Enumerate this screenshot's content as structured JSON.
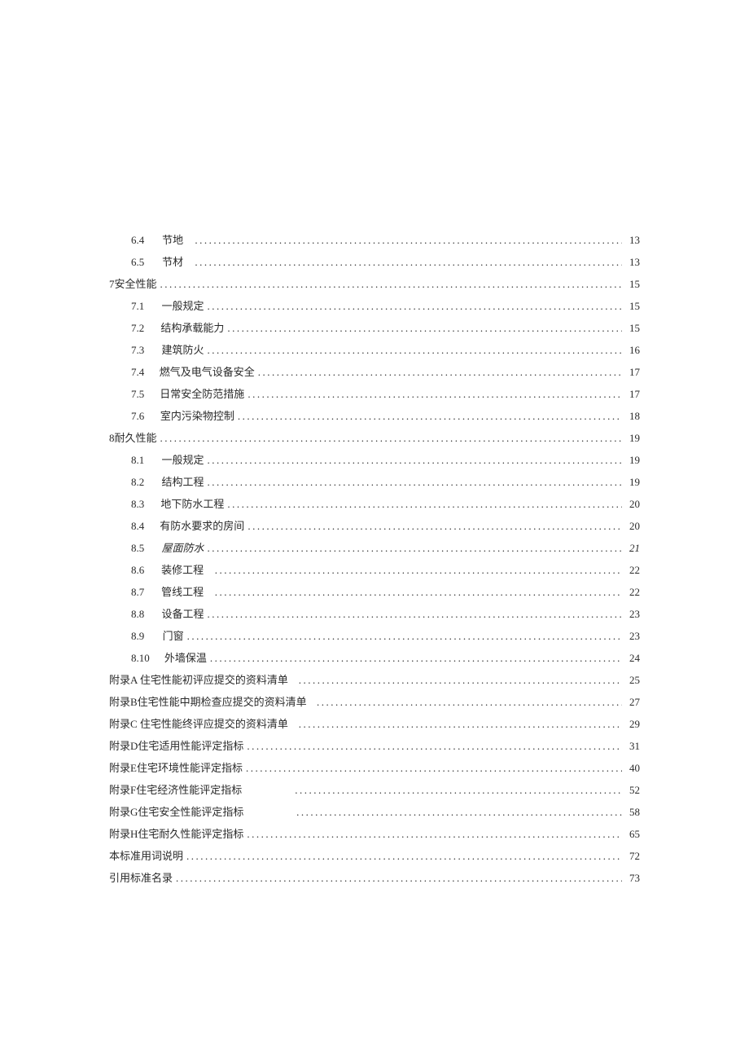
{
  "toc": {
    "entries": [
      {
        "level": "sub",
        "num": "6.4",
        "title": "节地",
        "gap": 14,
        "page": "13"
      },
      {
        "level": "sub",
        "num": "6.5",
        "title": "节材",
        "gap": 14,
        "page": "13"
      },
      {
        "level": "top",
        "num": "",
        "title": "7安全性能",
        "gap": 0,
        "page": "15"
      },
      {
        "level": "sub",
        "num": "7.1",
        "title": "一般规定",
        "gap": 0,
        "page": "15"
      },
      {
        "level": "sub",
        "num": "7.2",
        "title": "结构承载能力",
        "gap": 0,
        "page": "15"
      },
      {
        "level": "sub",
        "num": "7.3",
        "title": "建筑防火",
        "gap": 0,
        "page": "16"
      },
      {
        "level": "sub",
        "num": "7.4",
        "title": "燃气及电气设备安全",
        "gap": 0,
        "page": "17"
      },
      {
        "level": "sub",
        "num": "7.5",
        "title": "日常安全防范措施",
        "gap": 0,
        "page": "17"
      },
      {
        "level": "sub",
        "num": "7.6",
        "title": "室内污染物控制",
        "gap": 0,
        "page": "18"
      },
      {
        "level": "top",
        "num": "",
        "title": "8耐久性能",
        "gap": 0,
        "page": "19"
      },
      {
        "level": "sub",
        "num": "8.1",
        "title": "一般规定",
        "gap": 0,
        "page": "19"
      },
      {
        "level": "sub",
        "num": "8.2",
        "title": "结构工程",
        "gap": 0,
        "page": "19"
      },
      {
        "level": "sub",
        "num": "8.3",
        "title": "地下防水工程",
        "gap": 0,
        "page": "20"
      },
      {
        "level": "sub",
        "num": "8.4",
        "title": "有防水要求的房间",
        "gap": 0,
        "page": "20"
      },
      {
        "level": "sub",
        "num": "8.5",
        "title": "屋面防水",
        "gap": 0,
        "page": "21",
        "italic": true
      },
      {
        "level": "sub",
        "num": "8.6",
        "title": "装修工程",
        "gap": 14,
        "page": "22"
      },
      {
        "level": "sub",
        "num": "8.7",
        "title": "管线工程",
        "gap": 14,
        "page": "22"
      },
      {
        "level": "sub",
        "num": "8.8",
        "title": "设备工程",
        "gap": 0,
        "page": "23"
      },
      {
        "level": "sub",
        "num": "8.9",
        "title": "门窗",
        "gap": 0,
        "page": "23"
      },
      {
        "level": "sub",
        "num": "8.10",
        "title": "外墙保温",
        "gap": 0,
        "page": "24",
        "wideNum": true
      },
      {
        "level": "top",
        "num": "",
        "title": "附录A 住宅性能初评应提交的资料清单",
        "gap": 16,
        "page": "25"
      },
      {
        "level": "top",
        "num": "",
        "title": "附录B住宅性能中期检查应提交的资料清单",
        "gap": 16,
        "page": "27"
      },
      {
        "level": "top",
        "num": "",
        "title": "附录C 住宅性能终评应提交的资料清单",
        "gap": 16,
        "page": "29"
      },
      {
        "level": "top",
        "num": "",
        "title": "附录D住宅适用性能评定指标",
        "gap": 0,
        "page": "31"
      },
      {
        "level": "top",
        "num": "",
        "title": "附录E住宅环境性能评定指标",
        "gap": 0,
        "page": "40"
      },
      {
        "level": "top",
        "num": "",
        "title": "附录F住宅经济性能评定指标",
        "gap": 110,
        "page": "52"
      },
      {
        "level": "top",
        "num": "",
        "title": "附录G住宅安全性能评定指标",
        "gap": 110,
        "page": "58"
      },
      {
        "level": "top",
        "num": "",
        "title": "附录H住宅耐久性能评定指标",
        "gap": 0,
        "page": "65"
      },
      {
        "level": "top",
        "num": "",
        "title": "本标准用词说明",
        "gap": 0,
        "page": "72"
      },
      {
        "level": "top",
        "num": "",
        "title": "引用标准名录",
        "gap": 0,
        "page": "73"
      }
    ]
  }
}
